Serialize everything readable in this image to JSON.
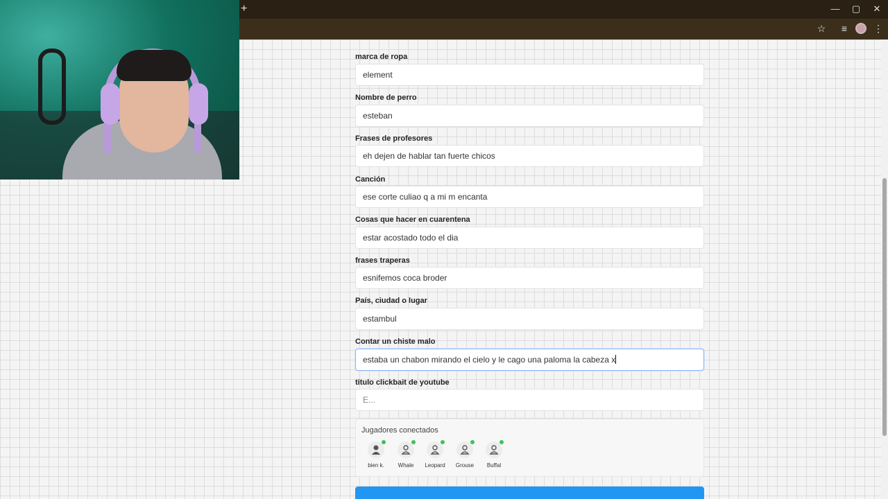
{
  "browser": {
    "new_tab_symbol": "+",
    "window_controls": [
      "—",
      "▢",
      "✕"
    ],
    "toolbar_icons": [
      "star-icon",
      "queue-icon",
      "profile-icon",
      "menu-icon"
    ]
  },
  "form": {
    "fields": [
      {
        "label": "marca de ropa",
        "value": "element"
      },
      {
        "label": "Nombre de perro",
        "value": "esteban"
      },
      {
        "label": "Frases de profesores",
        "value": "eh dejen de hablar tan fuerte chicos"
      },
      {
        "label": "Canción",
        "value": "ese corte culiao q a mi m encanta"
      },
      {
        "label": "Cosas que hacer en cuarentena",
        "value": "estar acostado todo el dia"
      },
      {
        "label": "frases traperas",
        "value": "esnifemos coca broder"
      },
      {
        "label": "País, ciudad o lugar",
        "value": "estambul"
      },
      {
        "label": "Contar un chiste malo",
        "value": "estaba un chabon mirando el cielo y le cago una paloma la cabeza x"
      },
      {
        "label": "titulo clickbait de youtube",
        "placeholder": "E..."
      }
    ]
  },
  "players": {
    "title": "Jugadores conectados",
    "list": [
      {
        "name": "bien k."
      },
      {
        "name": "Whale"
      },
      {
        "name": "Leopard"
      },
      {
        "name": "Grouse"
      },
      {
        "name": "Buffal"
      }
    ]
  },
  "colors": {
    "accent": "#2196f3",
    "online": "#3cc35a",
    "chrome": "#2a2013"
  }
}
